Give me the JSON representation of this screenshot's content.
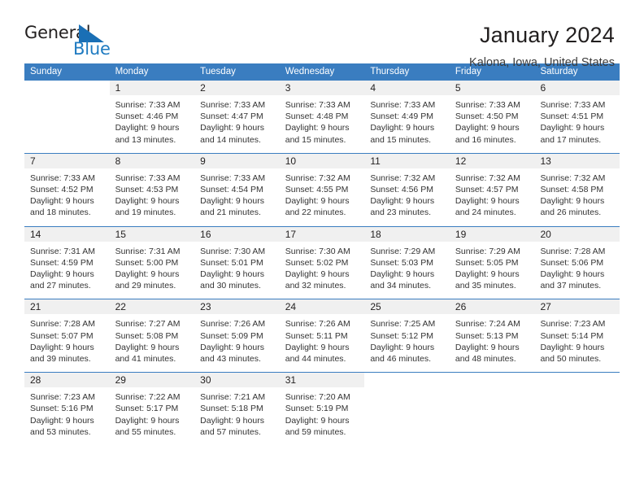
{
  "brand": {
    "name_part1": "General",
    "name_part2": "Blue",
    "logo_icon": "triangle-logo-icon",
    "accent_color": "#1f7bc1"
  },
  "header": {
    "title": "January 2024",
    "location": "Kalona, Iowa, United States"
  },
  "calendar": {
    "header_bg": "#3a7dc0",
    "daynum_bg": "#f0f0f0",
    "weekday_names": [
      "Sunday",
      "Monday",
      "Tuesday",
      "Wednesday",
      "Thursday",
      "Friday",
      "Saturday"
    ],
    "weeks": [
      {
        "days": [
          {
            "num": "",
            "sunrise": "",
            "sunset": "",
            "daylight1": "",
            "daylight2": ""
          },
          {
            "num": "1",
            "sunrise": "Sunrise: 7:33 AM",
            "sunset": "Sunset: 4:46 PM",
            "daylight1": "Daylight: 9 hours",
            "daylight2": "and 13 minutes."
          },
          {
            "num": "2",
            "sunrise": "Sunrise: 7:33 AM",
            "sunset": "Sunset: 4:47 PM",
            "daylight1": "Daylight: 9 hours",
            "daylight2": "and 14 minutes."
          },
          {
            "num": "3",
            "sunrise": "Sunrise: 7:33 AM",
            "sunset": "Sunset: 4:48 PM",
            "daylight1": "Daylight: 9 hours",
            "daylight2": "and 15 minutes."
          },
          {
            "num": "4",
            "sunrise": "Sunrise: 7:33 AM",
            "sunset": "Sunset: 4:49 PM",
            "daylight1": "Daylight: 9 hours",
            "daylight2": "and 15 minutes."
          },
          {
            "num": "5",
            "sunrise": "Sunrise: 7:33 AM",
            "sunset": "Sunset: 4:50 PM",
            "daylight1": "Daylight: 9 hours",
            "daylight2": "and 16 minutes."
          },
          {
            "num": "6",
            "sunrise": "Sunrise: 7:33 AM",
            "sunset": "Sunset: 4:51 PM",
            "daylight1": "Daylight: 9 hours",
            "daylight2": "and 17 minutes."
          }
        ]
      },
      {
        "days": [
          {
            "num": "7",
            "sunrise": "Sunrise: 7:33 AM",
            "sunset": "Sunset: 4:52 PM",
            "daylight1": "Daylight: 9 hours",
            "daylight2": "and 18 minutes."
          },
          {
            "num": "8",
            "sunrise": "Sunrise: 7:33 AM",
            "sunset": "Sunset: 4:53 PM",
            "daylight1": "Daylight: 9 hours",
            "daylight2": "and 19 minutes."
          },
          {
            "num": "9",
            "sunrise": "Sunrise: 7:33 AM",
            "sunset": "Sunset: 4:54 PM",
            "daylight1": "Daylight: 9 hours",
            "daylight2": "and 21 minutes."
          },
          {
            "num": "10",
            "sunrise": "Sunrise: 7:32 AM",
            "sunset": "Sunset: 4:55 PM",
            "daylight1": "Daylight: 9 hours",
            "daylight2": "and 22 minutes."
          },
          {
            "num": "11",
            "sunrise": "Sunrise: 7:32 AM",
            "sunset": "Sunset: 4:56 PM",
            "daylight1": "Daylight: 9 hours",
            "daylight2": "and 23 minutes."
          },
          {
            "num": "12",
            "sunrise": "Sunrise: 7:32 AM",
            "sunset": "Sunset: 4:57 PM",
            "daylight1": "Daylight: 9 hours",
            "daylight2": "and 24 minutes."
          },
          {
            "num": "13",
            "sunrise": "Sunrise: 7:32 AM",
            "sunset": "Sunset: 4:58 PM",
            "daylight1": "Daylight: 9 hours",
            "daylight2": "and 26 minutes."
          }
        ]
      },
      {
        "days": [
          {
            "num": "14",
            "sunrise": "Sunrise: 7:31 AM",
            "sunset": "Sunset: 4:59 PM",
            "daylight1": "Daylight: 9 hours",
            "daylight2": "and 27 minutes."
          },
          {
            "num": "15",
            "sunrise": "Sunrise: 7:31 AM",
            "sunset": "Sunset: 5:00 PM",
            "daylight1": "Daylight: 9 hours",
            "daylight2": "and 29 minutes."
          },
          {
            "num": "16",
            "sunrise": "Sunrise: 7:30 AM",
            "sunset": "Sunset: 5:01 PM",
            "daylight1": "Daylight: 9 hours",
            "daylight2": "and 30 minutes."
          },
          {
            "num": "17",
            "sunrise": "Sunrise: 7:30 AM",
            "sunset": "Sunset: 5:02 PM",
            "daylight1": "Daylight: 9 hours",
            "daylight2": "and 32 minutes."
          },
          {
            "num": "18",
            "sunrise": "Sunrise: 7:29 AM",
            "sunset": "Sunset: 5:03 PM",
            "daylight1": "Daylight: 9 hours",
            "daylight2": "and 34 minutes."
          },
          {
            "num": "19",
            "sunrise": "Sunrise: 7:29 AM",
            "sunset": "Sunset: 5:05 PM",
            "daylight1": "Daylight: 9 hours",
            "daylight2": "and 35 minutes."
          },
          {
            "num": "20",
            "sunrise": "Sunrise: 7:28 AM",
            "sunset": "Sunset: 5:06 PM",
            "daylight1": "Daylight: 9 hours",
            "daylight2": "and 37 minutes."
          }
        ]
      },
      {
        "days": [
          {
            "num": "21",
            "sunrise": "Sunrise: 7:28 AM",
            "sunset": "Sunset: 5:07 PM",
            "daylight1": "Daylight: 9 hours",
            "daylight2": "and 39 minutes."
          },
          {
            "num": "22",
            "sunrise": "Sunrise: 7:27 AM",
            "sunset": "Sunset: 5:08 PM",
            "daylight1": "Daylight: 9 hours",
            "daylight2": "and 41 minutes."
          },
          {
            "num": "23",
            "sunrise": "Sunrise: 7:26 AM",
            "sunset": "Sunset: 5:09 PM",
            "daylight1": "Daylight: 9 hours",
            "daylight2": "and 43 minutes."
          },
          {
            "num": "24",
            "sunrise": "Sunrise: 7:26 AM",
            "sunset": "Sunset: 5:11 PM",
            "daylight1": "Daylight: 9 hours",
            "daylight2": "and 44 minutes."
          },
          {
            "num": "25",
            "sunrise": "Sunrise: 7:25 AM",
            "sunset": "Sunset: 5:12 PM",
            "daylight1": "Daylight: 9 hours",
            "daylight2": "and 46 minutes."
          },
          {
            "num": "26",
            "sunrise": "Sunrise: 7:24 AM",
            "sunset": "Sunset: 5:13 PM",
            "daylight1": "Daylight: 9 hours",
            "daylight2": "and 48 minutes."
          },
          {
            "num": "27",
            "sunrise": "Sunrise: 7:23 AM",
            "sunset": "Sunset: 5:14 PM",
            "daylight1": "Daylight: 9 hours",
            "daylight2": "and 50 minutes."
          }
        ]
      },
      {
        "days": [
          {
            "num": "28",
            "sunrise": "Sunrise: 7:23 AM",
            "sunset": "Sunset: 5:16 PM",
            "daylight1": "Daylight: 9 hours",
            "daylight2": "and 53 minutes."
          },
          {
            "num": "29",
            "sunrise": "Sunrise: 7:22 AM",
            "sunset": "Sunset: 5:17 PM",
            "daylight1": "Daylight: 9 hours",
            "daylight2": "and 55 minutes."
          },
          {
            "num": "30",
            "sunrise": "Sunrise: 7:21 AM",
            "sunset": "Sunset: 5:18 PM",
            "daylight1": "Daylight: 9 hours",
            "daylight2": "and 57 minutes."
          },
          {
            "num": "31",
            "sunrise": "Sunrise: 7:20 AM",
            "sunset": "Sunset: 5:19 PM",
            "daylight1": "Daylight: 9 hours",
            "daylight2": "and 59 minutes."
          },
          {
            "num": "",
            "sunrise": "",
            "sunset": "",
            "daylight1": "",
            "daylight2": ""
          },
          {
            "num": "",
            "sunrise": "",
            "sunset": "",
            "daylight1": "",
            "daylight2": ""
          },
          {
            "num": "",
            "sunrise": "",
            "sunset": "",
            "daylight1": "",
            "daylight2": ""
          }
        ]
      }
    ]
  }
}
